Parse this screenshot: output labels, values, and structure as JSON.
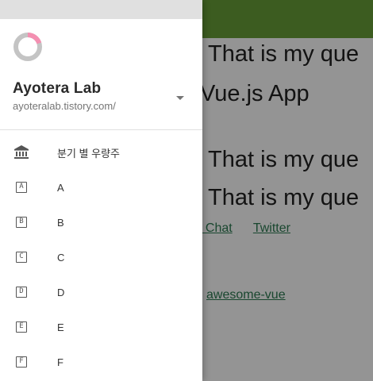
{
  "background_app": {
    "lines": [
      "That is my que",
      "Vue.js App",
      "That is my que",
      "That is my que"
    ],
    "links": [
      "/ Chat",
      "Twitter"
    ],
    "ecosystem_link": "awesome-vue"
  },
  "drawer": {
    "account": {
      "name": "Ayotera Lab",
      "url": "ayoteralab.tistory.com/"
    },
    "items": [
      {
        "icon": "bank-icon",
        "label": "분기 별 우량주"
      },
      {
        "icon": "letter-a-icon",
        "glyph": "A",
        "label": "A"
      },
      {
        "icon": "letter-b-icon",
        "glyph": "B",
        "label": "B"
      },
      {
        "icon": "letter-c-icon",
        "glyph": "C",
        "label": "C"
      },
      {
        "icon": "letter-d-icon",
        "glyph": "D",
        "label": "D"
      },
      {
        "icon": "letter-e-icon",
        "glyph": "E",
        "label": "E"
      },
      {
        "icon": "letter-f-icon",
        "glyph": "F",
        "label": "F"
      }
    ]
  },
  "colors": {
    "app_bar": "#689f38",
    "logo_ring": "#c4c4c4",
    "logo_accent": "#f48fb1",
    "link": "#2c7a52"
  }
}
